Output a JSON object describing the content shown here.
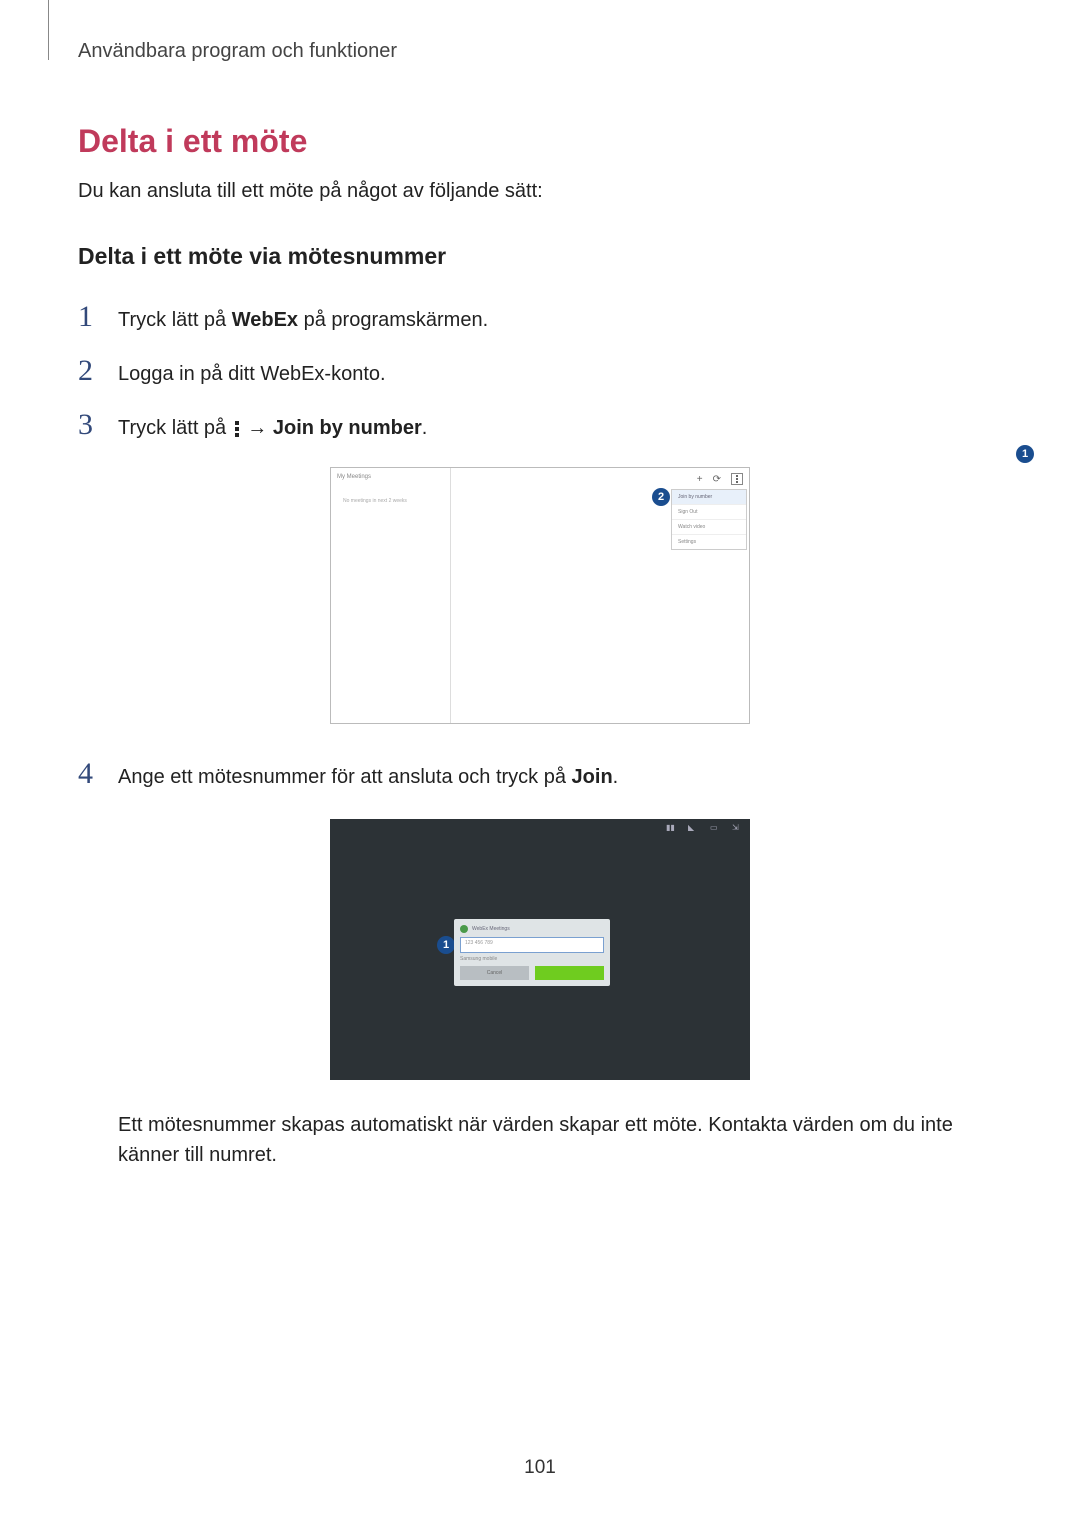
{
  "breadcrumb": "Användbara program och funktioner",
  "title": "Delta i ett möte",
  "intro": "Du kan ansluta till ett möte på något av följande sätt:",
  "subsection": "Delta i ett möte via mötesnummer",
  "steps": {
    "s1": {
      "num": "1",
      "pre": "Tryck lätt på ",
      "bold": "WebEx",
      "post": " på programskärmen."
    },
    "s2": {
      "num": "2",
      "text": "Logga in på ditt WebEx-konto."
    },
    "s3": {
      "num": "3",
      "pre": "Tryck lätt på ",
      "arrow": " → ",
      "bold": "Join by number",
      "post": "."
    },
    "s4": {
      "num": "4",
      "pre": "Ange ett mötesnummer för att ansluta och tryck på ",
      "bold": "Join",
      "post": "."
    }
  },
  "screenshot1": {
    "sidebar_title": "My Meetings",
    "sidebar_msg": "No meetings in next 2 weeks",
    "plus": "+",
    "refresh": "⟳",
    "dropdown": [
      "Join by number",
      "Sign Out",
      "Watch video",
      "Settings"
    ]
  },
  "callouts": {
    "one": "1",
    "two": "2"
  },
  "screenshot2": {
    "dialog_title": "WebEx Meetings",
    "placeholder": "123 456 789",
    "subtitle": "Samsung mobile",
    "cancel": "Cancel",
    "join": ""
  },
  "note": "Ett mötesnummer skapas automatiskt när värden skapar ett möte. Kontakta värden om du inte känner till numret.",
  "page_number": "101"
}
